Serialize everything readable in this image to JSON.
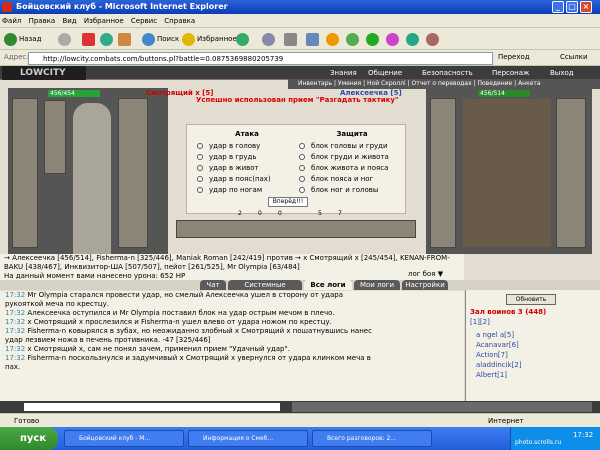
{
  "window": {
    "title": "Бойцовский клуб - Microsoft Internet Explorer"
  },
  "menu": [
    "Файл",
    "Правка",
    "Вид",
    "Избранное",
    "Сервис",
    "Справка"
  ],
  "toolbar": {
    "back": "Назад",
    "search": "Поиск",
    "favorites": "Избранное"
  },
  "address": {
    "label": "Адрес:",
    "url": "http://lowcity.combats.com/buttons.pl?battle=0.0875369880205739",
    "go": "Переход",
    "links": "Ссылки"
  },
  "site": {
    "logo": "LOWCITY",
    "nav": [
      "Знания",
      "Общение",
      "Безопасность",
      "Персонаж",
      "Выход"
    ],
    "subnav": "Инвентарь | Умения | Ной Скроллi | Отчет о переводах | Поведение | Анкета"
  },
  "fight": {
    "left_hp": "456/454",
    "right_hp": "456/514",
    "left_name": "Алексеечка [5]",
    "target": "Смотрящий х [5]",
    "right_name": "Алексеечка [5]",
    "right_target": "",
    "success": "Успешно использован прием \"Разгадать тактику\"",
    "attack_header": "Атака",
    "defense_header": "Защита",
    "attacks": [
      "удар в голову",
      "удар в грудь",
      "удар в живот",
      "удар в пояс(пах)",
      "удар по ногам"
    ],
    "defenses": [
      "блок головы и груди",
      "блок груди и живота",
      "блок живота и пояса",
      "блок пояса и ног",
      "блок ног и головы"
    ],
    "forward": "Вперёд!!!",
    "counts": [
      "2",
      "0",
      "0",
      "5",
      "7"
    ]
  },
  "participants": {
    "line1": "→ Алексеечка [456/514], Fisherma-n [325/446], Maniak Roman [242/419] против → х Смотрящий х [245/454], KENAN-FROM-",
    "line2": "BAKU [438/467], Инквизитор-ША [507/507], пейот [261/525], Mr Olympia [63/484]",
    "note": "На данный момент вами нанесено урона: 652 HP",
    "logs": "лог боя ▼"
  },
  "tabs": [
    "Чат",
    "Системные сообщения",
    "Все логи",
    "Мои логи",
    "Настройки"
  ],
  "chat": [
    {
      "time": "17:32",
      "text": "Mr Olympia старался провести удар, но смелый Алексеечка ушел в сторону от удара"
    },
    {
      "time": "",
      "text": "рукояткой меча по крестцу."
    },
    {
      "time": "17:32",
      "text": "Алексеечка оступился и Mr Olympia поставил блок на удар острым мечом в плечо."
    },
    {
      "time": "17:32",
      "text": "х Смотрящий х прослезился и Fisherma-n ушел влево от удара ножом по крестцу."
    },
    {
      "time": "17:32",
      "text": "Fisherma-n ковырялся в зубах, но неожиданно злобный х Смотрящий х пошатнувшись нанес"
    },
    {
      "time": "",
      "text": "удар лезвием ножа в печень противника. -47 [325/446]"
    },
    {
      "time": "17:32",
      "text": "х Смотрящий х, сам не понял зачем, применил прием \"Удачный удар\"."
    },
    {
      "time": "17:32",
      "text": "Fisherma-n поскользнулся и задумчивый х Смотрящий х увернулся от удара клинком меча в"
    },
    {
      "time": "",
      "text": "пах."
    }
  ],
  "right_panel": {
    "refresh": "Обновить",
    "hall": "Зал воинов 3 (448)",
    "pages": "[1][2]",
    "users": [
      "a ngel a[5]",
      "Acanavar[6]",
      "Action[7]",
      "aladdincik[2]",
      "Albert[1]"
    ]
  },
  "status": {
    "left": "Готово",
    "right": "Интернет"
  },
  "taskbar": {
    "start": "пуск",
    "items": [
      "Бойцовский клуб - М...",
      "Информация о Смеб...",
      "Всего разговоров: 2..."
    ],
    "time": "17:32",
    "watermark": "photo.scrolls.ru"
  }
}
